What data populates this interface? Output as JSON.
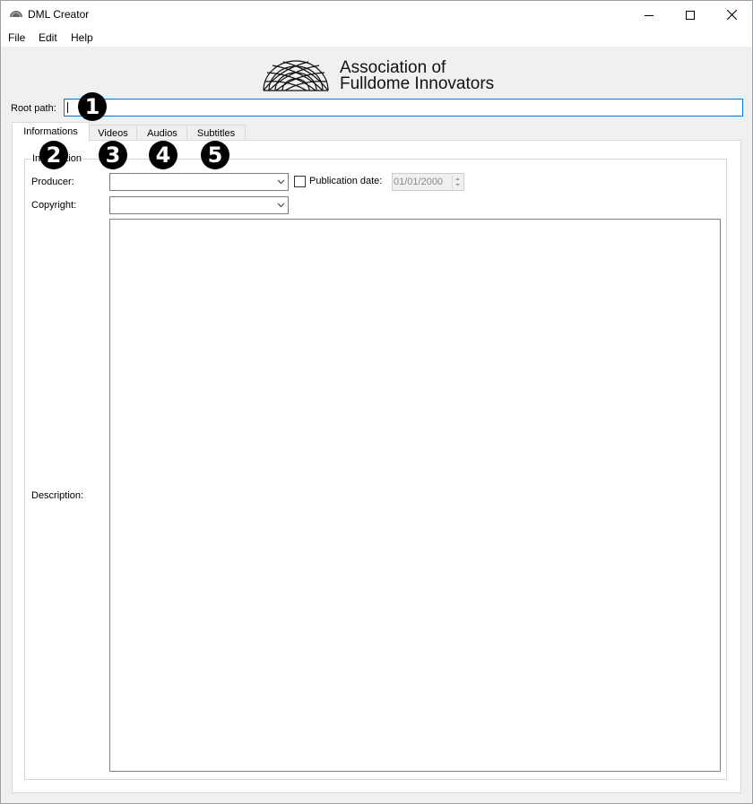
{
  "window": {
    "title": "DML Creator"
  },
  "menu": {
    "items": [
      "File",
      "Edit",
      "Help"
    ]
  },
  "logo": {
    "line1": "Association of",
    "line2": "Fulldome Innovators"
  },
  "root_path": {
    "label": "Root path:",
    "value": ""
  },
  "tabs": [
    "Informations",
    "Videos",
    "Audios",
    "Subtitles"
  ],
  "active_tab": "Informations",
  "information": {
    "group_title": "Information",
    "producer_label": "Producer:",
    "producer_value": "",
    "copyright_label": "Copyright:",
    "copyright_value": "",
    "publication_date_label": "Publication date:",
    "publication_date_checked": false,
    "publication_date_value": "01/01/2000",
    "description_label": "Description:",
    "description_value": ""
  },
  "badges": [
    "1",
    "2",
    "3",
    "4",
    "5"
  ]
}
